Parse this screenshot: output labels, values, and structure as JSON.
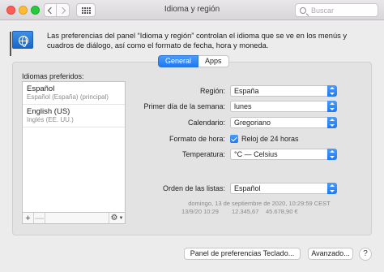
{
  "window": {
    "title": "Idioma y región",
    "search_placeholder": "Buscar"
  },
  "header": {
    "icon": "globe-flag-icon",
    "description": "Las preferencias del panel “Idioma y región” controlan el idioma que se ve en los menús y cuadros de diálogo, así como el formato de fecha, hora y moneda."
  },
  "tabs": [
    {
      "label": "General",
      "active": true
    },
    {
      "label": "Apps",
      "active": false
    }
  ],
  "languages": {
    "title": "Idiomas preferidos:",
    "items": [
      {
        "name": "Español",
        "sub": "Español (España) (principal)"
      },
      {
        "name": "English (US)",
        "sub": "Inglés (EE. UU.)"
      }
    ],
    "add_label": "+",
    "remove_label": "—"
  },
  "form": {
    "region": {
      "label": "Región:",
      "value": "España"
    },
    "first_day": {
      "label": "Primer día de la semana:",
      "value": "lunes"
    },
    "calendar": {
      "label": "Calendario:",
      "value": "Gregoriano"
    },
    "time_format": {
      "label": "Formato de hora:",
      "check_label": "Reloj de 24 horas",
      "checked": true
    },
    "temperature": {
      "label": "Temperatura:",
      "value": "°C — Celsius"
    },
    "list_order": {
      "label": "Orden de las listas:",
      "value": "Español"
    }
  },
  "sample": {
    "date_long": "domingo, 13 de septiembre de 2020, 10:29:59 CEST",
    "date_short": "13/9/20 10:29",
    "number": "12.345,67",
    "currency": "45.678,90 €"
  },
  "buttons": {
    "keyboard": "Panel de preferencias Teclado...",
    "advanced": "Avanzado...",
    "help": "?"
  },
  "colors": {
    "accent": "#1f78f3"
  }
}
